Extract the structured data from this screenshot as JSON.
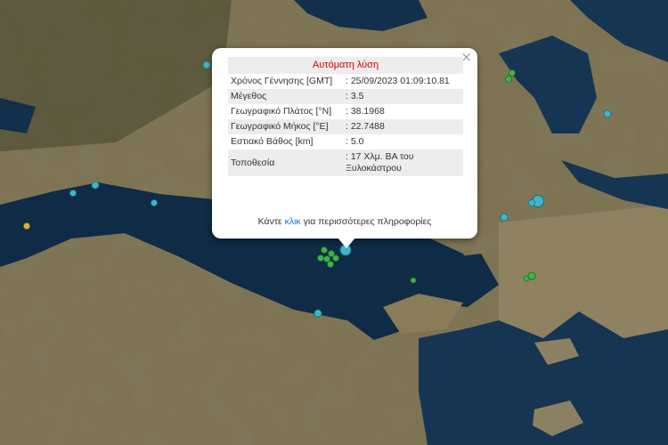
{
  "popup": {
    "title": "Αυτόματη λύση",
    "close_symbol": "×",
    "rows": [
      {
        "label": "Χρόνος Γέννησης [GMT]",
        "value": ": 25/09/2023 01:09:10.81"
      },
      {
        "label": "Μέγεθος",
        "value": ": 3.5"
      },
      {
        "label": "Γεωγραφικό Πλάτος [°N]",
        "value": ": 38.1968"
      },
      {
        "label": "Γεωγραφικό Μήκος [°E]",
        "value": ": 22.7488"
      },
      {
        "label": "Εστιακό Βάθος [km]",
        "value": ": 5.0"
      },
      {
        "label": "Τοποθεσία",
        "value": ": 17 Χλμ. ΒΑ του Ξυλοκάστρου"
      }
    ],
    "more_prefix": "Κάντε ",
    "more_link": "κλικ",
    "more_suffix": " για περισσότερες πληροφορίες"
  },
  "colors": {
    "sea": "#0f2b45",
    "land_dark": "#4a4a30",
    "land_light": "#8c8062",
    "marker_cyan": "#3fb6cc",
    "marker_green": "#3fb24a",
    "marker_yellow": "#d9b437",
    "title_red": "#cc0000",
    "link_blue": "#1a73c7"
  }
}
